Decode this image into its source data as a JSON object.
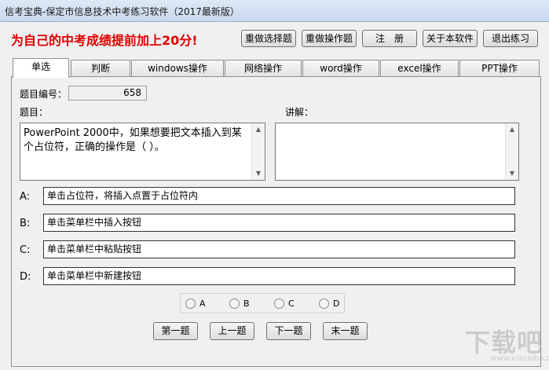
{
  "window": {
    "title": "信考宝典-保定市信息技术中考练习软件（2017最新版）"
  },
  "header": {
    "slogan": "为自己的中考成绩提前加上20分!"
  },
  "toolbar": {
    "redo_choice": "重做选择题",
    "redo_operation": "重做操作题",
    "register": "注　册",
    "about": "关于本软件",
    "exit": "退出练习"
  },
  "tabs": [
    {
      "label": "单选",
      "active": true
    },
    {
      "label": "判断",
      "active": false
    },
    {
      "label": "windows操作",
      "active": false
    },
    {
      "label": "网络操作",
      "active": false
    },
    {
      "label": "word操作",
      "active": false
    },
    {
      "label": "excel操作",
      "active": false
    },
    {
      "label": "PPT操作",
      "active": false
    }
  ],
  "question": {
    "number_label": "题目编号：",
    "number": "658",
    "title_label": "题目：",
    "text": "PowerPoint 2000中，如果想要把文本插入到某个占位符，正确的操作是（ ）。",
    "explain_label": "讲解：",
    "explain_text": ""
  },
  "options": [
    {
      "letter": "A:",
      "text": "单击占位符，将插入点置于占位符内"
    },
    {
      "letter": "B:",
      "text": "单击菜单栏中插入按钮"
    },
    {
      "letter": "C:",
      "text": "单击菜单栏中粘贴按钮"
    },
    {
      "letter": "D:",
      "text": "单击菜单栏中新建按钮"
    }
  ],
  "answers": [
    "A",
    "B",
    "C",
    "D"
  ],
  "nav": {
    "first": "第一题",
    "prev": "上一题",
    "next": "下一题",
    "last": "末一题"
  },
  "watermark": {
    "brand": "下载吧",
    "domain": "www.xiazaiba.com"
  },
  "colors": {
    "slogan": "#e00000",
    "title_bar": "#c7d8ee"
  }
}
